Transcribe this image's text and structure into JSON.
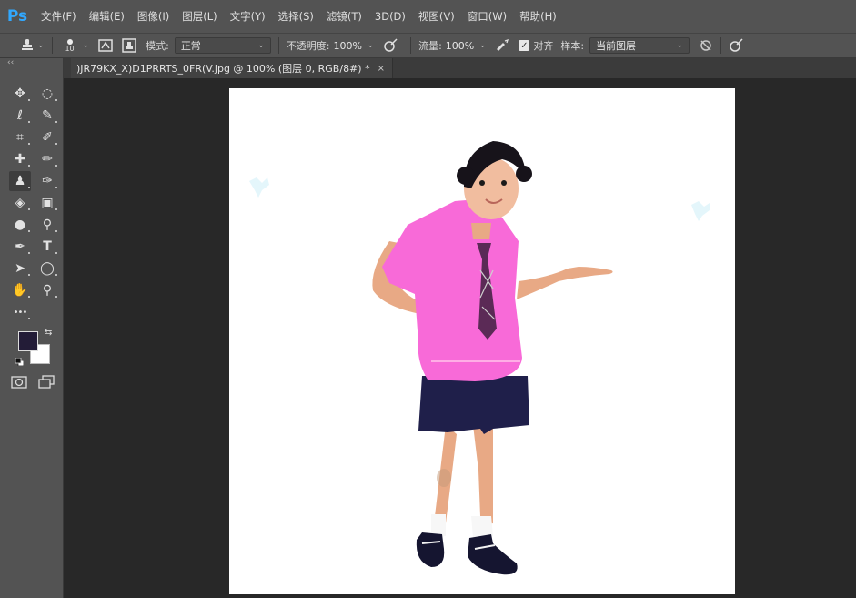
{
  "app": {
    "logo": "Ps"
  },
  "menu": [
    "文件(F)",
    "编辑(E)",
    "图像(I)",
    "图层(L)",
    "文字(Y)",
    "选择(S)",
    "滤镜(T)",
    "3D(D)",
    "视图(V)",
    "窗口(W)",
    "帮助(H)"
  ],
  "options": {
    "brush_size": "10",
    "mode_label": "模式:",
    "mode_value": "正常",
    "opacity_label": "不透明度:",
    "opacity_value": "100%",
    "flow_label": "流量:",
    "flow_value": "100%",
    "align_label": "对齐",
    "align_checked": true,
    "sample_label": "样本:",
    "sample_value": "当前图层"
  },
  "document": {
    "tab_title": ")JR79KX_X)D1PRRTS_0FR(V.jpg @ 100% (图层 0, RGB/8#) *",
    "close_glyph": "×"
  },
  "colors": {
    "foreground": "#231c37",
    "background": "#ffffff",
    "shirt": "#f86ad8",
    "shorts": "#1f1f4a",
    "accent": "#31a8ff"
  },
  "tools": [
    {
      "name": "move-tool",
      "glyph": "✥"
    },
    {
      "name": "marquee-tool",
      "glyph": "◌"
    },
    {
      "name": "lasso-tool",
      "glyph": "ℓ"
    },
    {
      "name": "quick-selection-tool",
      "glyph": "✎"
    },
    {
      "name": "crop-tool",
      "glyph": "⌗"
    },
    {
      "name": "eyedropper-tool",
      "glyph": "✐"
    },
    {
      "name": "healing-brush-tool",
      "glyph": "✚"
    },
    {
      "name": "brush-tool",
      "glyph": "✏"
    },
    {
      "name": "clone-stamp-tool",
      "glyph": "♟"
    },
    {
      "name": "history-brush-tool",
      "glyph": "✑"
    },
    {
      "name": "eraser-tool",
      "glyph": "◈"
    },
    {
      "name": "gradient-tool",
      "glyph": "▣"
    },
    {
      "name": "blur-tool",
      "glyph": "●"
    },
    {
      "name": "dodge-tool",
      "glyph": "⚲"
    },
    {
      "name": "pen-tool",
      "glyph": "✒"
    },
    {
      "name": "type-tool",
      "glyph": "T"
    },
    {
      "name": "path-selection-tool",
      "glyph": "➤"
    },
    {
      "name": "ellipse-tool",
      "glyph": "◯"
    },
    {
      "name": "hand-tool",
      "glyph": "✋"
    },
    {
      "name": "zoom-tool",
      "glyph": "⚲"
    }
  ],
  "more_tools_glyph": "•••"
}
